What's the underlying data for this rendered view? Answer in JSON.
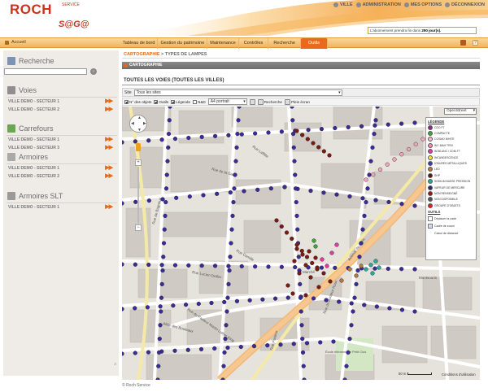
{
  "header": {
    "logo_main": "ROCH",
    "logo_service": "SERVICE",
    "logo_product": "S@G@",
    "top_links": [
      {
        "label": "VILLE",
        "icon": "user-icon"
      },
      {
        "label": "ADMINISTRATION",
        "icon": "settings-icon"
      },
      {
        "label": "MES OPTIONS",
        "icon": "options-icon"
      },
      {
        "label": "DÉCONNEXION",
        "icon": "power-icon"
      }
    ],
    "subscription_prefix": "L'abonnement prendra fin dans",
    "subscription_days": "290 jour(s).",
    "colors": {
      "brand": "#c8341c",
      "accent": "#e96a1c"
    }
  },
  "menu": {
    "home": "Accueil",
    "tabs": [
      "Tableau de bord",
      "Gestion du patrimoine",
      "Maintenance",
      "Contrôles",
      "Recherche",
      "Outils"
    ],
    "active_tab": "Outils"
  },
  "sidebar": {
    "search_title": "Recherche",
    "sections": [
      {
        "title": "Voies",
        "icon": "road-icon",
        "items": [
          "VILLE DEMO - SECTEUR 1",
          "VILLE DEMO - SECTEUR 2"
        ]
      },
      {
        "title": "Carrefours",
        "icon": "crossroad-icon",
        "items": [
          "VILLE DEMO - SECTEUR 1",
          "VILLE DEMO - SECTEUR 3"
        ]
      },
      {
        "title": "Armoires",
        "icon": "cabinet-icon",
        "items": [
          "VILLE DEMO - SECTEUR 1",
          "VILLE DEMO - SECTEUR 2"
        ]
      },
      {
        "title": "Armoires SLT",
        "icon": "cabinet-slt-icon",
        "items": [
          "VILLE DEMO - SECTEUR 1"
        ]
      }
    ]
  },
  "content": {
    "breadcrumb_link": "CARTOGRAPHIE",
    "breadcrumb_rest": " > TYPES DE LAMPES",
    "panel_title": "CARTOGRAPHIE",
    "voies_title": "TOUTES LES VOIES (TOUTES LES VILLES)"
  },
  "toolbar": {
    "site_label": "Site",
    "site_value": "Tous les sites",
    "check_objets": "N° des objets",
    "check_outils": "Outils",
    "check_legende": "Légende",
    "check_n40": "N&D",
    "paper_value": "A4 portrait",
    "recherche": "Recherche",
    "plein_ecran": "Plein écran"
  },
  "map": {
    "map_type": "OpenStreet",
    "legend_title": "LÉGENDE",
    "legend": [
      {
        "label": "CDO FT",
        "color": "#8b2a8b"
      },
      {
        "label": "COMPACTE",
        "color": "#3aa83a"
      },
      {
        "label": "COSMO WHITE",
        "color": "#f2b8c6"
      },
      {
        "label": "IM / MAH TRSI",
        "color": "#f48ab4"
      },
      {
        "label": "IM BLANC / CDM-TT",
        "color": "#e23aa6"
      },
      {
        "label": "INCANDESCENCE",
        "color": "#f5e63a"
      },
      {
        "label": "IODURES MÉTALLIQUES",
        "color": "#3a3ab8"
      },
      {
        "label": "LED",
        "color": "#b8763a"
      },
      {
        "label": "SHP",
        "color": "#5a1a0a"
      },
      {
        "label": "SODIUM BASSE PRESSION",
        "color": "#2aa89a"
      },
      {
        "label": "VAPEUR DE MERCURE",
        "color": "#2a2a6a"
      },
      {
        "label": "NON RENSEIGNÉ",
        "color": "#a01010"
      },
      {
        "label": "NON DISPONIBLE",
        "color": "#555555"
      },
      {
        "label": "GROUPE D'OBJETS",
        "color": "#e02020"
      }
    ],
    "tools_title": "OUTILS",
    "tools": [
      "Déplacer la carte",
      "Cadre de zoom",
      "Calcul de distance"
    ],
    "scale": "50 m",
    "conditions": "Conditions d'utilisation",
    "streets": [
      "Rue de Bagneux",
      "Rue Camille",
      "Rue Lucien Dellier",
      "Rue de la Gare",
      "Rue du Pasteur Martin Luther King",
      "Allée des Bouleaux",
      "Rue Pasteur",
      "Avenue de Paris",
      "Rue Laffitte",
      "Montsouris",
      "Marché",
      "Rue du Docteur Roux",
      "École élémentaire Petit Clos"
    ]
  },
  "footer": {
    "credit": "© Roch Service"
  }
}
